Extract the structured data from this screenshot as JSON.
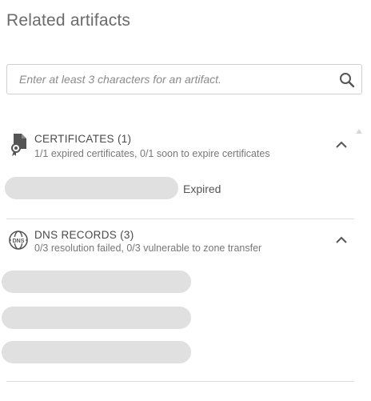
{
  "panel": {
    "title": "Related artifacts"
  },
  "search": {
    "placeholder": "Enter at least 3 characters for an artifact.",
    "icon": "search-icon"
  },
  "sections": [
    {
      "name": "CERTIFICATES",
      "count": "(1)",
      "summary": "1/1 expired certificates, 0/1 soon to expire certificates",
      "icon": "certificate-icon",
      "expanded": true,
      "items": [
        {
          "status": "Expired"
        }
      ]
    },
    {
      "name": "DNS RECORDS",
      "count": "(3)",
      "summary": "0/3 resolution failed, 0/3 vulnerable to zone transfer",
      "icon": "dns-globe-icon",
      "icon_text": "DNS",
      "expanded": true,
      "items": [
        {},
        {},
        {}
      ]
    }
  ],
  "colors": {
    "skeleton": "#e0e0e0",
    "divider": "#dcdcdc",
    "text": "#4a4a4a",
    "muted": "#777777"
  }
}
